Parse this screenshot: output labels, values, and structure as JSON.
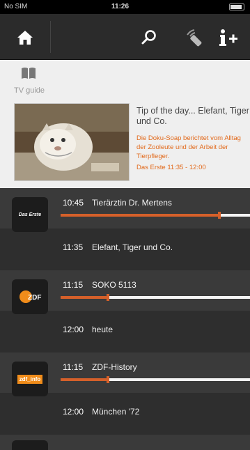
{
  "status_bar": {
    "carrier": "No SIM",
    "time": "11:26"
  },
  "toolbar": {
    "home_icon": "home-icon",
    "search_icon": "search-icon",
    "remote_icon": "remote-control-icon",
    "info_add_icon": "info-plus-icon"
  },
  "featured": {
    "section_label": "TV guide",
    "tip_title": "Tip of the day... Elefant, Tiger und Co.",
    "tip_description": "Die Doku-Soap berichtet vom Alltag der Zooleute und der Arbeit der Tierpfleger.",
    "tip_airtime": "Das Erste 11:35 - 12:00"
  },
  "channels": [
    {
      "logo_text": "Das Erste",
      "now_time": "10:45",
      "now_title": "Tierärztin Dr. Mertens",
      "progress": 0.84,
      "next_time": "11:35",
      "next_title": "Elefant, Tiger und Co."
    },
    {
      "logo_text": "ZDF",
      "now_time": "11:15",
      "now_title": "SOKO 5113",
      "progress": 0.25,
      "next_time": "12:00",
      "next_title": "heute"
    },
    {
      "logo_text": "zdf_info",
      "now_time": "11:15",
      "now_title": "ZDF-History",
      "progress": 0.25,
      "next_time": "12:00",
      "next_title": "München '72"
    }
  ],
  "colors": {
    "accent": "#d5602a",
    "text_accent": "#e26a1c"
  }
}
